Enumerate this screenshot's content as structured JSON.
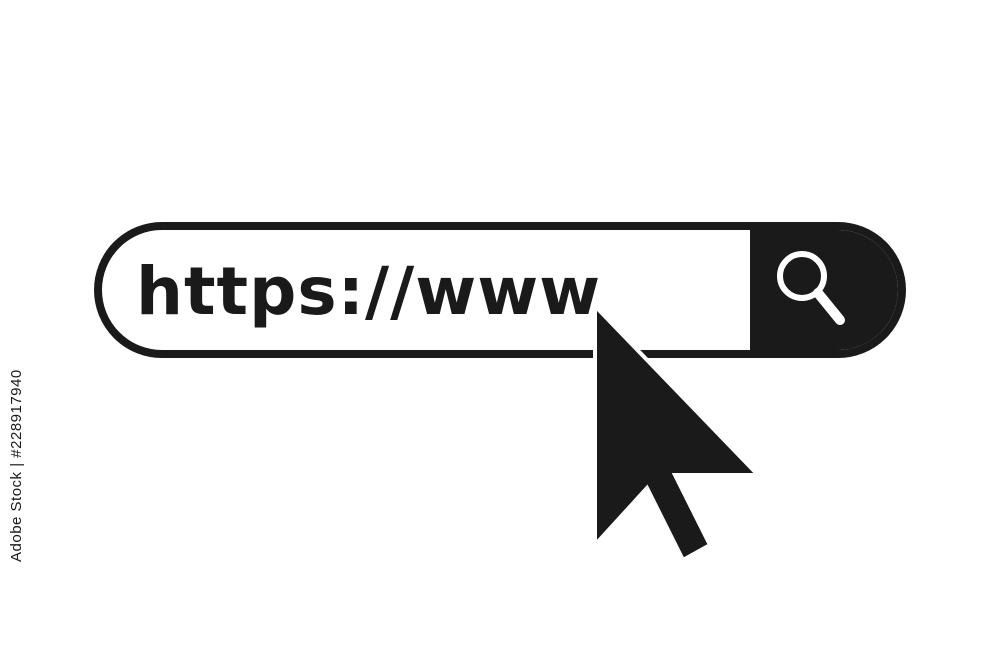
{
  "address_bar": {
    "url_text": "https://www",
    "search_icon": "magnifier-icon"
  },
  "cursor": {
    "icon": "arrow-pointer-icon"
  },
  "watermark": {
    "side_text": "Adobe Stock | #228917940"
  },
  "colors": {
    "foreground": "#1a1a1a",
    "background": "#ffffff"
  }
}
